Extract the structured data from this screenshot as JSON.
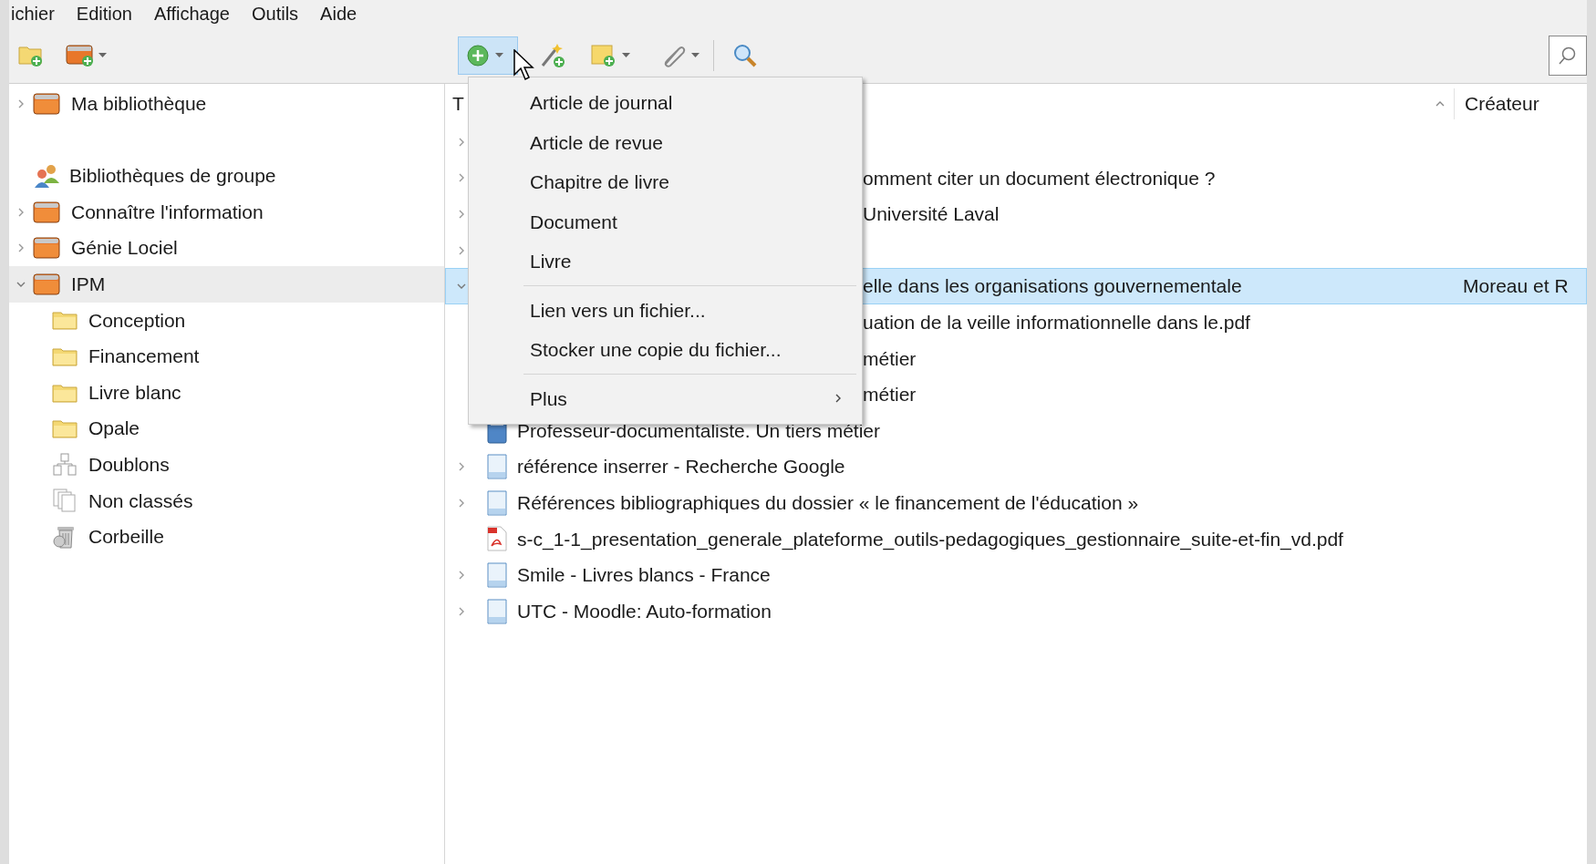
{
  "menubar": [
    "ichier",
    "Edition",
    "Affichage",
    "Outils",
    "Aide"
  ],
  "toolbar": {
    "new_item_pressed": true
  },
  "collections": [
    {
      "label": "Ma bibliothèque",
      "kind": "library",
      "expanded": false,
      "selected": false
    },
    {
      "label": "Bibliothèques de groupe",
      "kind": "group-header",
      "selected": false
    },
    {
      "label": "Connaître l'information",
      "kind": "library",
      "expanded": false,
      "selected": false
    },
    {
      "label": "Génie Lociel",
      "kind": "library",
      "expanded": false,
      "selected": false
    },
    {
      "label": "IPM",
      "kind": "library",
      "expanded": true,
      "selected": true,
      "children": [
        {
          "label": "Conception",
          "kind": "folder",
          "selected": false
        },
        {
          "label": "Financement",
          "kind": "folder",
          "selected": false
        },
        {
          "label": "Livre blanc",
          "kind": "folder",
          "selected": false
        },
        {
          "label": "Opale",
          "kind": "folder",
          "selected": false
        },
        {
          "label": "Doublons",
          "kind": "duplicates",
          "selected": false
        },
        {
          "label": "Non classés",
          "kind": "unfiled",
          "selected": false
        },
        {
          "label": "Corbeille",
          "kind": "trash",
          "selected": false
        }
      ]
    }
  ],
  "columns": [
    {
      "label": "T",
      "sort_ascending": true
    },
    {
      "label": "Créateur"
    }
  ],
  "items": [
    {
      "expandable": true,
      "expanded": false,
      "covered": true,
      "selected": false
    },
    {
      "title": "omment citer un document électronique ?",
      "expandable": true,
      "expanded": false,
      "covered": true,
      "selected": false
    },
    {
      "title": "Université Laval",
      "expandable": true,
      "expanded": false,
      "covered": true,
      "selected": false
    },
    {
      "expandable": true,
      "expanded": false,
      "covered": true,
      "selected": false
    },
    {
      "title": "elle dans les organisations gouvernementale",
      "creator": "Moreau et R",
      "expandable": true,
      "expanded": true,
      "covered": true,
      "selected": true
    },
    {
      "title": "uation de la veille informationnelle dans le.pdf",
      "expandable": false,
      "covered": true,
      "selected": false
    },
    {
      "title": "métier",
      "expandable": false,
      "covered": true,
      "selected": false
    },
    {
      "title": "métier",
      "expandable": false,
      "covered": true,
      "selected": false
    },
    {
      "title": "Professeur-documentaliste. Un tiers métier",
      "kind": "book",
      "expandable": false,
      "covered": false,
      "selected": false
    },
    {
      "title": "référence inserrer - Recherche Google",
      "kind": "webpage",
      "expandable": true,
      "expanded": false,
      "covered": false,
      "selected": false
    },
    {
      "title": "Références bibliographiques du dossier « le financement de l'éducation »",
      "kind": "webpage",
      "expandable": true,
      "expanded": false,
      "covered": false,
      "selected": false
    },
    {
      "title": "s-c_1-1_presentation_generale_plateforme_outils-pedagogiques_gestionnaire_suite-et-fin_vd.pdf",
      "kind": "pdf",
      "expandable": false,
      "covered": false,
      "selected": false
    },
    {
      "title": "Smile - Livres blancs - France",
      "kind": "webpage",
      "expandable": true,
      "expanded": false,
      "covered": false,
      "selected": false
    },
    {
      "title": "UTC - Moodle: Auto-formation",
      "kind": "webpage",
      "expandable": true,
      "expanded": false,
      "covered": false,
      "selected": false
    }
  ],
  "new_item_menu": [
    {
      "kind": "item",
      "label": "Article de journal"
    },
    {
      "kind": "item",
      "label": "Article de revue"
    },
    {
      "kind": "item",
      "label": "Chapitre de livre"
    },
    {
      "kind": "item",
      "label": "Document"
    },
    {
      "kind": "item",
      "label": "Livre"
    },
    {
      "kind": "separator"
    },
    {
      "kind": "item",
      "label": "Lien vers un fichier..."
    },
    {
      "kind": "item",
      "label": "Stocker une copie du fichier..."
    },
    {
      "kind": "separator"
    },
    {
      "kind": "submenu",
      "label": "Plus"
    }
  ]
}
